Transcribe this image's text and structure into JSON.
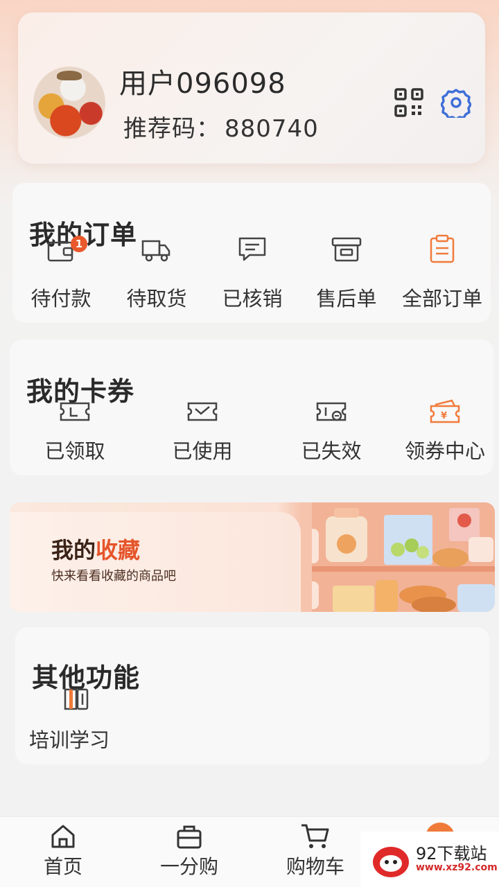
{
  "profile": {
    "username": "用户096098",
    "referral_label": "推荐码：",
    "referral_code": "880740"
  },
  "orders": {
    "title": "我的订单",
    "badge": "1",
    "items": [
      {
        "label": "待付款",
        "icon": "wallet-icon"
      },
      {
        "label": "待取货",
        "icon": "truck-icon"
      },
      {
        "label": "已核销",
        "icon": "message-icon"
      },
      {
        "label": "售后单",
        "icon": "box-icon"
      },
      {
        "label": "全部订单",
        "icon": "clipboard-icon"
      }
    ]
  },
  "coupons": {
    "title": "我的卡券",
    "items": [
      {
        "label": "已领取",
        "icon": "ticket-icon"
      },
      {
        "label": "已使用",
        "icon": "ticket-check-icon"
      },
      {
        "label": "已失效",
        "icon": "ticket-expired-icon"
      },
      {
        "label": "领券中心",
        "icon": "coupon-center-icon"
      }
    ]
  },
  "favorites": {
    "title_part1": "我的",
    "title_part2": "收藏",
    "subtitle": "快来看看收藏的商品吧"
  },
  "other": {
    "title": "其他功能",
    "items": [
      {
        "label": "培训学习",
        "icon": "book-icon"
      }
    ]
  },
  "nav": {
    "items": [
      {
        "label": "首页",
        "icon": "home-icon"
      },
      {
        "label": "一分购",
        "icon": "bag-icon"
      },
      {
        "label": "购物车",
        "icon": "cart-icon"
      }
    ]
  },
  "watermark": {
    "text": "92下载站",
    "url": "www.xz92.com"
  },
  "colors": {
    "accent": "#f07a3a",
    "gear": "#3f6fd8",
    "badge": "#e9592b"
  }
}
